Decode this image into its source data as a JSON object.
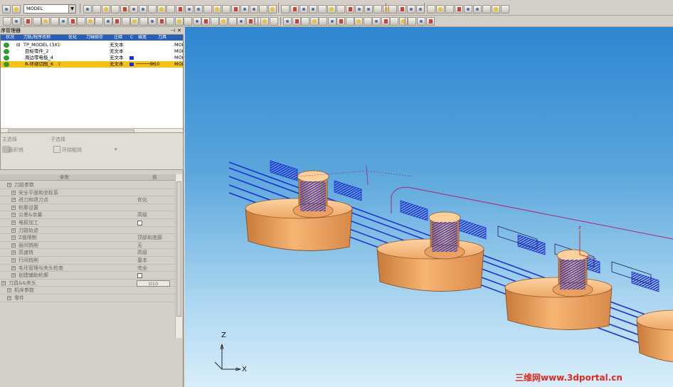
{
  "toolbar": {
    "geometry_combo": "MODEL"
  },
  "navigator": {
    "title": "序管理器",
    "columns": [
      "状况",
      "刀轨/程序名称",
      "优化",
      "刀轴锁存",
      "注释",
      "C",
      "描宽",
      "刀具"
    ],
    "rows": [
      {
        "name": "TP_MODEL (3X)",
        "optimize": "",
        "comment": "无文本",
        "tool": "",
        "right": "MOD",
        "selected": false
      },
      {
        "name": "目标零件_2",
        "optimize": "",
        "comment": "无文本",
        "tool": "",
        "right": "MOD",
        "selected": false
      },
      {
        "name": "周边零电极_4",
        "optimize": "",
        "comment": "无文本",
        "tool": "",
        "right": "MOD",
        "selected": false
      },
      {
        "name": "R-环绕切削_6",
        "optimize": "",
        "comment": "无文本",
        "tool": "D10",
        "right": "MOD",
        "selected": true
      }
    ]
  },
  "selection": {
    "main_label": "主选择",
    "main_value": "面积铣",
    "sub_label": "子选择",
    "sub_value": "环绕粗铣"
  },
  "params": {
    "header_param": "参数",
    "header_value": "值",
    "rows": [
      {
        "label": "刀路参数",
        "value": "",
        "indent": 1
      },
      {
        "label": "安全平面和坐标系",
        "value": "",
        "indent": 2
      },
      {
        "label": "进刀和退刀点",
        "value": "优化",
        "indent": 2
      },
      {
        "label": "轮廓设置",
        "value": "",
        "indent": 2
      },
      {
        "label": "公差&余量",
        "value": "高级",
        "indent": 2
      },
      {
        "label": "电极加工",
        "value": "",
        "indent": 2
      },
      {
        "label": "刀路轨迹",
        "value": "",
        "indent": 2
      },
      {
        "label": "Z值限制",
        "value": "顶部和底部",
        "indent": 2
      },
      {
        "label": "层间铣削",
        "value": "无",
        "indent": 2
      },
      {
        "label": "高速铣",
        "value": "高级",
        "indent": 2
      },
      {
        "label": "行间铣削",
        "value": "基本",
        "indent": 2
      },
      {
        "label": "毛坯管理与夹头检查",
        "value": "完全",
        "indent": 2
      },
      {
        "label": "创建辅助轮廓",
        "value": "",
        "indent": 2
      },
      {
        "label": "刀具&&夹头",
        "value": "D10",
        "indent": 0
      },
      {
        "label": "机床参数",
        "value": "",
        "indent": 1
      },
      {
        "label": "零件",
        "value": "",
        "indent": 1
      }
    ]
  },
  "viewport": {
    "axis_z": "Z",
    "axis_x": "X",
    "watermark": "三维网www.3dportal.cn"
  },
  "colors": {
    "selected_row": "#f6c21a",
    "header_blue": "#2a5fb8",
    "toolpath": "#1f2fd0",
    "part": "#f0a65c"
  }
}
